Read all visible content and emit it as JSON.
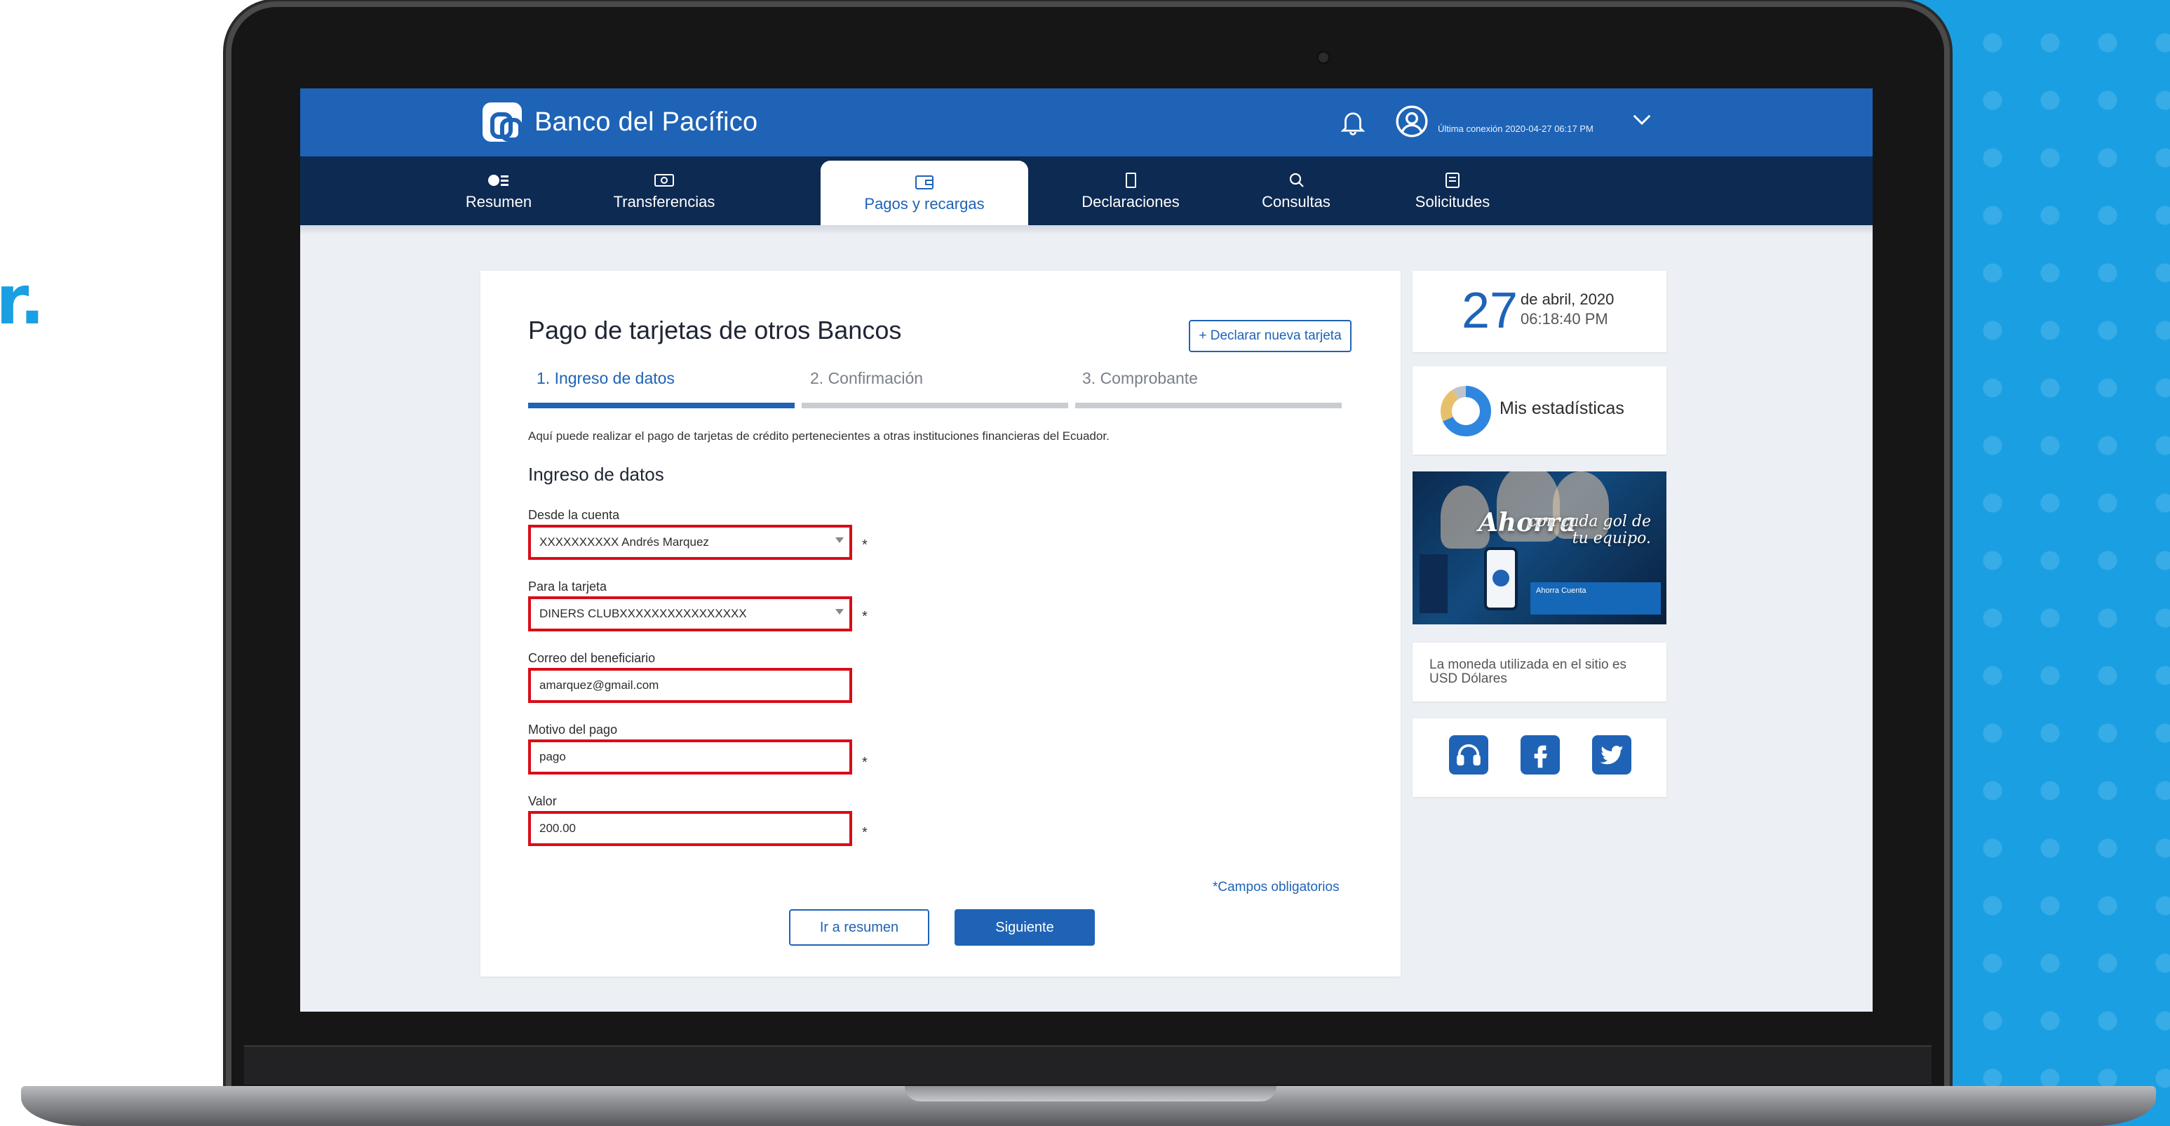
{
  "side_text": "r.",
  "app": {
    "bank_name": "Banco del Pacífico",
    "last_connection": "Última conexión 2020-04-27 06:17 PM"
  },
  "nav": {
    "items": [
      {
        "label": "Resumen",
        "icon": "money-list-icon",
        "active": false
      },
      {
        "label": "Transferencias",
        "icon": "cash-icon",
        "active": false
      },
      {
        "label": "Pagos y recargas",
        "icon": "wallet-icon",
        "active": true
      },
      {
        "label": "Declaraciones",
        "icon": "document-icon",
        "active": false
      },
      {
        "label": "Consultas",
        "icon": "search-icon",
        "active": false
      },
      {
        "label": "Solicitudes",
        "icon": "form-icon",
        "active": false
      }
    ]
  },
  "form": {
    "title": "Pago de tarjetas de otros Bancos",
    "declare_button": "+ Declarar nueva tarjeta",
    "steps": [
      {
        "label": "1.  Ingreso de datos",
        "active": true
      },
      {
        "label": "2.  Confirmación",
        "active": false
      },
      {
        "label": "3.  Comprobante",
        "active": false
      }
    ],
    "intro": "Aquí puede realizar el pago de tarjetas de crédito pertenecientes a otras instituciones financieras del Ecuador.",
    "section_title": "Ingreso de datos",
    "fields": {
      "from_account": {
        "label": "Desde la cuenta",
        "value": "XXXXXXXXXX Andrés Marquez"
      },
      "to_card": {
        "label": "Para la tarjeta",
        "value": "DINERS CLUBXXXXXXXXXXXXXXXX"
      },
      "email": {
        "label": "Correo del beneficiario",
        "value": "amarquez@gmail.com"
      },
      "reason": {
        "label": "Motivo del pago",
        "value": "pago"
      },
      "amount": {
        "label": "Valor",
        "value": "200.00"
      }
    },
    "required_mark": "*",
    "required_note": "*Campos obligatorios",
    "back_button": "Ir a resumen",
    "next_button": "Siguiente"
  },
  "sidebar": {
    "date_day": "27",
    "date_month": "de abril, 2020",
    "date_time": "06:18:40 PM",
    "stats_label": "Mis estadísticas",
    "banner": {
      "headline": "Ahorra",
      "sub": "con cada gol de tu equipo.",
      "strip_text": "Ahorra Cuenta"
    },
    "currency_note": "La moneda utilizada en el sitio es USD Dólares"
  },
  "colors": {
    "brand_blue": "#1e63b6",
    "nav_dark": "#0d2a52",
    "field_border": "#d90d18",
    "backdrop": "#1aa0e2"
  }
}
